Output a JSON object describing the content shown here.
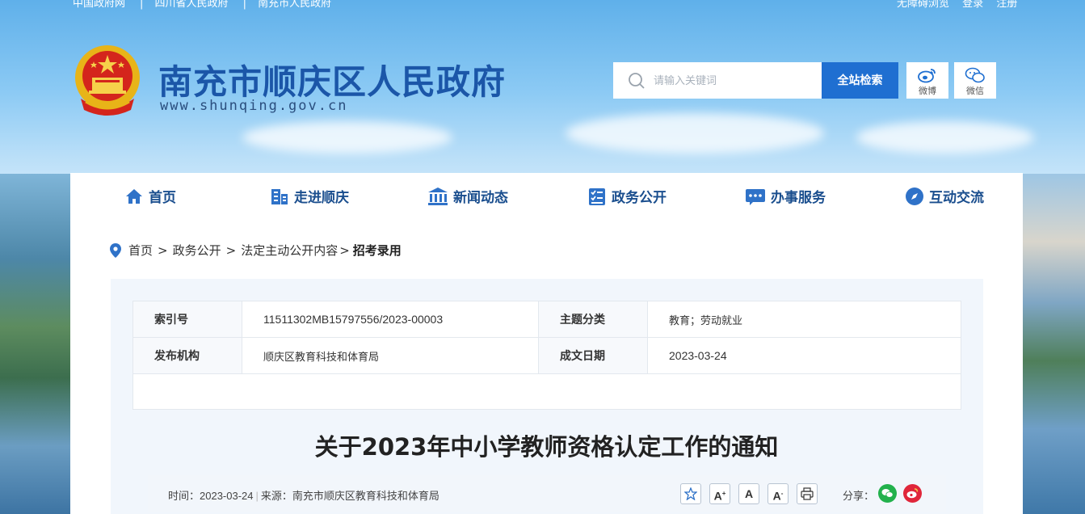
{
  "topbar": {
    "left_links": [
      "中国政府网",
      "四川省人民政府",
      "南充市人民政府"
    ],
    "right_links": [
      "无障碍浏览",
      "登录",
      "注册"
    ]
  },
  "header": {
    "site_title": "南充市顺庆区人民政府",
    "site_url": "www.shunqing.gov.cn",
    "search_placeholder": "请输入关键词",
    "search_button": "全站检索",
    "weibo_label": "微博",
    "weixin_label": "微信"
  },
  "nav": {
    "items": [
      {
        "label": "首页",
        "icon": "home-icon"
      },
      {
        "label": "走进顺庆",
        "icon": "building-icon"
      },
      {
        "label": "新闻动态",
        "icon": "museum-icon"
      },
      {
        "label": "政务公开",
        "icon": "checklist-icon"
      },
      {
        "label": "办事服务",
        "icon": "service-icon"
      },
      {
        "label": "互动交流",
        "icon": "compass-icon"
      }
    ]
  },
  "breadcrumb": {
    "items": [
      "首页",
      "政务公开",
      "法定主动公开内容"
    ],
    "current": "招考录用"
  },
  "meta": {
    "index_label": "索引号",
    "index_value": "11511302MB15797556/2023-00003",
    "topic_label": "主题分类",
    "topic_value": "教育；劳动就业",
    "org_label": "发布机构",
    "org_value": "顺庆区教育科技和体育局",
    "date_label": "成文日期",
    "date_value": "2023-03-24"
  },
  "article": {
    "title": "关于2023年中小学教师资格认定工作的通知",
    "time_label": "时间：",
    "time_value": "2023-03-24",
    "source_label": "来源：",
    "source_value": "南充市顺庆区教育科技和体育局",
    "font_large": "A",
    "font_normal": "A",
    "font_small": "A",
    "share_label": "分享："
  },
  "colors": {
    "brand_blue": "#1b56a8",
    "search_blue": "#1f6fd1",
    "wechat_green": "#22b14c",
    "weibo_red": "#e0263a"
  }
}
